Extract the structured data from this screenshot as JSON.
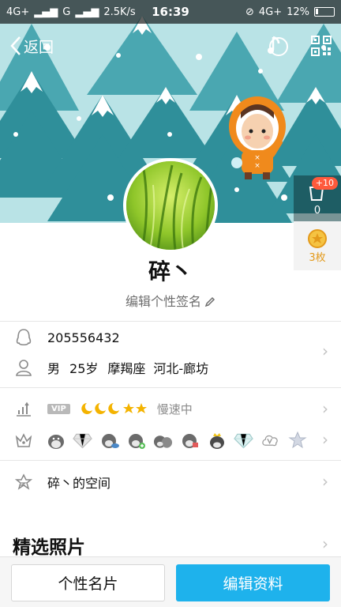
{
  "status_bar": {
    "network_left": "4G+",
    "network_mid": "G",
    "speed": "2.5K/s",
    "time": "16:39",
    "network_right": "4G+",
    "battery": "12%"
  },
  "nav": {
    "back_label": "返回",
    "music_icon": "music-note-icon",
    "qr_icon": "qr-code-icon"
  },
  "side": {
    "gift_bubble": "+10",
    "gift_count": "0",
    "medal_count": "3枚"
  },
  "profile": {
    "name": "碎丶",
    "signature": "编辑个性签名"
  },
  "info": {
    "qq_number": "205556432",
    "gender": "男",
    "age": "25岁",
    "zodiac": "摩羯座",
    "location": "河北-廊坊"
  },
  "level": {
    "vip_label": "VIP",
    "status": "慢速中"
  },
  "space": {
    "label": "碎丶的空间"
  },
  "photos": {
    "title": "精选照片"
  },
  "buttons": {
    "card_label": "个性名片",
    "edit_label": "编辑资料"
  },
  "colors": {
    "accent": "#1eb2ec",
    "sky": "#b9e3e6",
    "tree": "#2f8f9a",
    "snow": "#ffffff",
    "vip_tag": "#b9b9b9",
    "medal": "#e39a1b",
    "bubble": "#ff5a3c"
  }
}
